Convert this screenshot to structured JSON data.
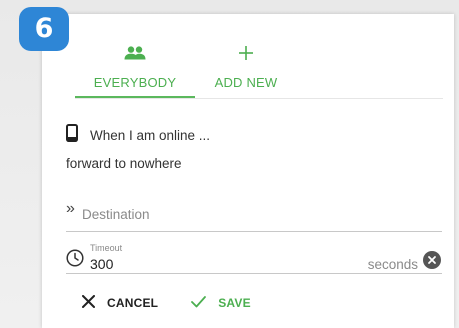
{
  "step": {
    "number": "6"
  },
  "tabs": [
    {
      "label": "EVERYBODY",
      "icon": "people-icon",
      "active": true
    },
    {
      "label": "ADD NEW",
      "icon": "plus-icon",
      "active": false
    }
  ],
  "rule": {
    "condition_icon": "phone-icon",
    "condition_text": "When I am online ...",
    "action_text": "forward to nowhere"
  },
  "destination": {
    "icon": "double-chevron-icon",
    "placeholder": "Destination",
    "value": ""
  },
  "timeout": {
    "label": "Timeout",
    "value": "300",
    "unit": "seconds"
  },
  "actions": {
    "cancel_label": "CANCEL",
    "save_label": "SAVE"
  },
  "colors": {
    "accent": "#4caf50",
    "badge": "#2e86d6"
  }
}
